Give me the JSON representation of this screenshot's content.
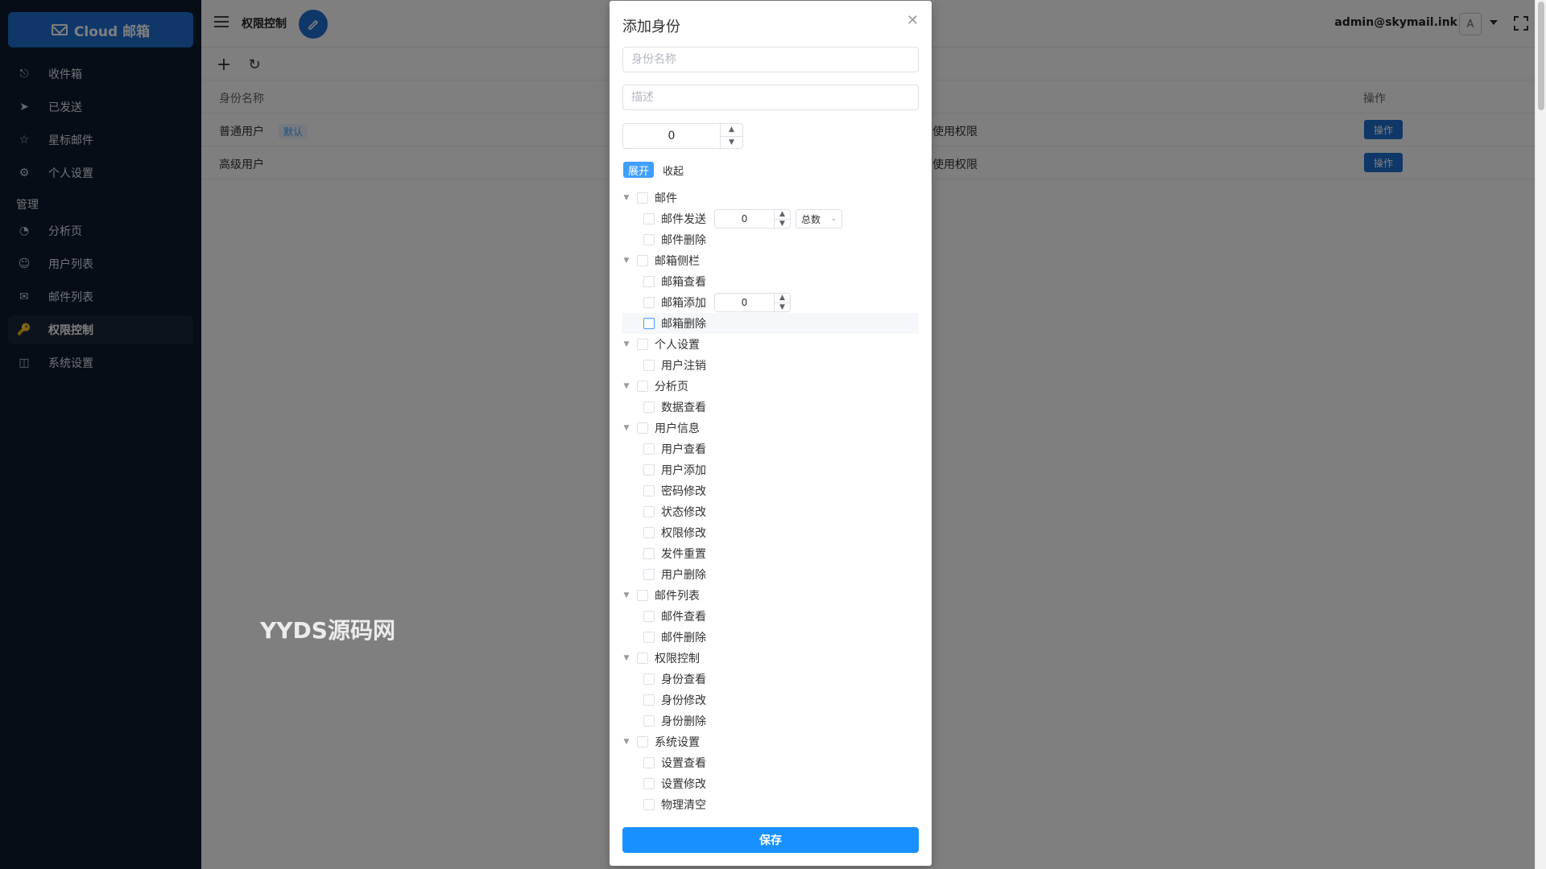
{
  "app": {
    "brand": "Cloud 邮箱"
  },
  "sidebar": {
    "items": [
      {
        "label": "收件箱",
        "icon": "inbox-icon"
      },
      {
        "label": "已发送",
        "icon": "send-icon"
      },
      {
        "label": "星标邮件",
        "icon": "star-icon"
      },
      {
        "label": "个人设置",
        "icon": "gear-icon"
      }
    ],
    "section": "管理",
    "admin_items": [
      {
        "label": "分析页",
        "icon": "pie-chart-icon"
      },
      {
        "label": "用户列表",
        "icon": "user-icon"
      },
      {
        "label": "邮件列表",
        "icon": "mail-list-icon"
      },
      {
        "label": "权限控制",
        "icon": "key-icon",
        "active": true
      },
      {
        "label": "系统设置",
        "icon": "monitor-settings-icon"
      }
    ]
  },
  "header": {
    "title": "权限控制",
    "user_email": "admin@skymail.ink",
    "avatar_letter": "A"
  },
  "table": {
    "columns": [
      "身份名称",
      "操作"
    ],
    "rows": [
      {
        "name": "普通用户",
        "tag": "默认",
        "perm": "使用权限",
        "action": "操作"
      },
      {
        "name": "高级用户",
        "tag": "",
        "perm": "使用权限",
        "action": "操作"
      }
    ]
  },
  "watermark": "YYDS源码网",
  "dialog": {
    "title": "添加身份",
    "name_placeholder": "身份名称",
    "desc_placeholder": "描述",
    "sort_value": "0",
    "expand_label": "展开",
    "collapse_label": "收起",
    "tree": [
      {
        "label": "邮件",
        "children": [
          {
            "label": "邮件发送",
            "stepper": "0",
            "select": "总数"
          },
          {
            "label": "邮件删除"
          }
        ]
      },
      {
        "label": "邮箱侧栏",
        "children": [
          {
            "label": "邮箱查看"
          },
          {
            "label": "邮箱添加",
            "stepper": "0"
          },
          {
            "label": "邮箱删除",
            "hover": true
          }
        ]
      },
      {
        "label": "个人设置",
        "children": [
          {
            "label": "用户注销"
          }
        ]
      },
      {
        "label": "分析页",
        "children": [
          {
            "label": "数据查看"
          }
        ]
      },
      {
        "label": "用户信息",
        "children": [
          {
            "label": "用户查看"
          },
          {
            "label": "用户添加"
          },
          {
            "label": "密码修改"
          },
          {
            "label": "状态修改"
          },
          {
            "label": "权限修改"
          },
          {
            "label": "发件重置"
          },
          {
            "label": "用户删除"
          }
        ]
      },
      {
        "label": "邮件列表",
        "children": [
          {
            "label": "邮件查看"
          },
          {
            "label": "邮件删除"
          }
        ]
      },
      {
        "label": "权限控制",
        "children": [
          {
            "label": "身份查看"
          },
          {
            "label": "身份修改"
          },
          {
            "label": "身份删除"
          }
        ]
      },
      {
        "label": "系统设置",
        "children": [
          {
            "label": "设置查看"
          },
          {
            "label": "设置修改"
          },
          {
            "label": "物理清空"
          }
        ]
      }
    ],
    "save_label": "保存"
  }
}
